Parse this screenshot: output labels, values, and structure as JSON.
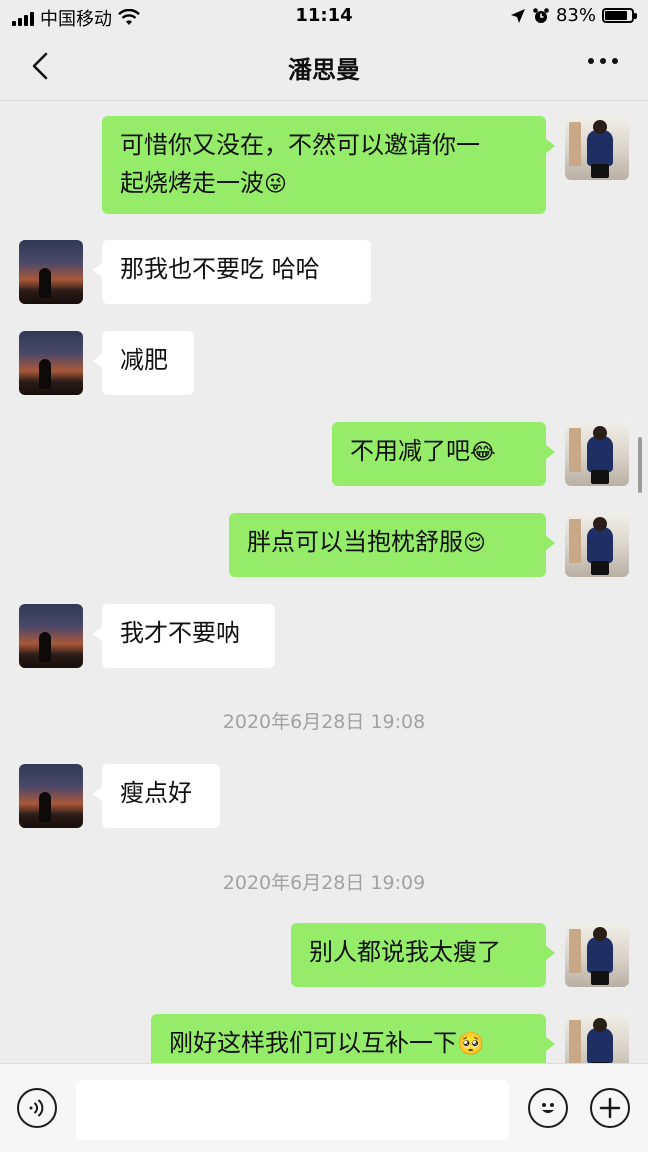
{
  "status_bar": {
    "carrier": "中国移动",
    "time": "11:14",
    "battery": "83%",
    "battery_level": 0.83
  },
  "nav": {
    "title": "潘思曼",
    "back_icon": "chevron-left-icon",
    "more_icon": "more-dots-icon"
  },
  "messages": [
    {
      "side": "right",
      "text": "可惜你又没在，不然可以邀请你一",
      "text2": "起烧烤走一波",
      "emoji": "😜"
    },
    {
      "side": "left",
      "text": "那我也不要吃 哈哈"
    },
    {
      "side": "left",
      "text": "减肥"
    },
    {
      "side": "right",
      "text": "不用减了吧",
      "emoji": "😂"
    },
    {
      "side": "right",
      "text": "胖点可以当抱枕舒服",
      "emoji": "😌"
    },
    {
      "side": "left",
      "text": "我才不要呐"
    },
    {
      "timestamp": "2020年6月28日 19:08"
    },
    {
      "side": "left",
      "text": "瘦点好"
    },
    {
      "timestamp": "2020年6月28日 19:09"
    },
    {
      "side": "right",
      "text": "别人都说我太瘦了"
    },
    {
      "side": "right",
      "text": "刚好这样我们可以互补一下",
      "emoji": "🥺"
    }
  ],
  "input_bar": {
    "voice_icon": "voice-icon",
    "input_value": "",
    "emoji_icon": "emoji-face-icon",
    "plus_icon": "plus-icon"
  }
}
